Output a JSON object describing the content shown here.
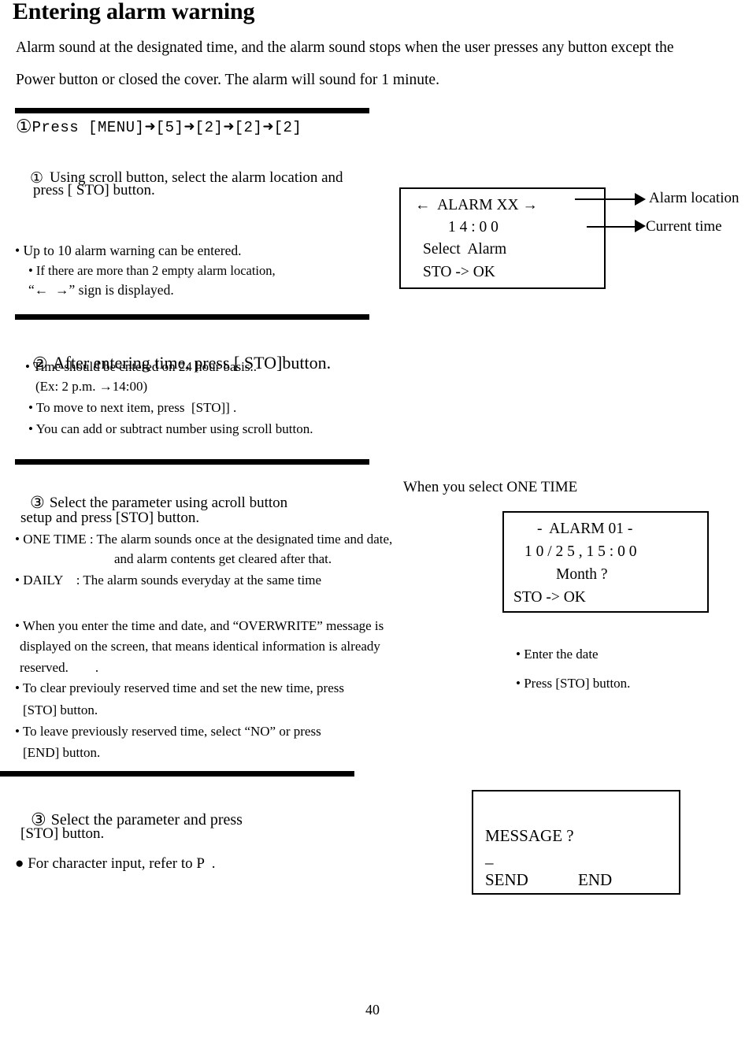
{
  "document": {
    "title": "Entering alarm warning",
    "intro_line1": "Alarm sound at the designated time, and the alarm sound stops when the user presses any button except the",
    "intro_line2": "Power button or closed the cover. The alarm will sound for 1 minute.",
    "page_number": "40"
  },
  "step1": {
    "number": "①",
    "key_sequence_prefix": "Press  [MENU]",
    "arrow": "➜",
    "key1": "[5]",
    "key2": "[2]",
    "key3": "[2]",
    "key4": "[2]",
    "sub_number": "①",
    "sub_line1": "Using scroll button, select the alarm location and",
    "sub_line2": "press [ STO] button.",
    "notes": [
      "• Up to 10 alarm warning can be entered.",
      "• If there are more than 2 empty alarm location,",
      "“←  →” sign is displayed."
    ]
  },
  "lcd1": {
    "line1": "←  ALARM XX →",
    "line2": "1 4 : 0 0",
    "line3": "Select  Alarm",
    "line4": "STO -> OK",
    "callout1": "Alarm location",
    "callout2": "Current time"
  },
  "step2": {
    "number": "②",
    "heading": "After entering time, press [ STO]button.",
    "notes": [
      "• Time should be entered on 24 hour basis..",
      "(Ex: 2 p.m. →14:00)",
      "• To move to next item, press  [STO]] .",
      "• You can add or subtract number using scroll button."
    ]
  },
  "step3": {
    "number": "③",
    "heading": "Select the parameter using acroll button",
    "heading2": "setup and press [STO] button.",
    "right_label": "When you select ONE TIME",
    "notes": [
      "• ONE TIME : The alarm sounds once at the designated time and date,",
      "and alarm contents get cleared after that.",
      "• DAILY    : The alarm sounds everyday at the same time"
    ],
    "overwrite_notes": [
      "• When you enter the time and date, and “OVERWRITE” message is",
      "displayed on the screen, that means identical information is already",
      "reserved.        .",
      "• To clear previouly reserved time and set the new time, press",
      "[STO] button.",
      "• To leave previously reserved time, select “NO” or press",
      "[END] button."
    ]
  },
  "lcd2": {
    "line1": "-  ALARM 01 -",
    "line2": "1 0 / 2 5 , 1 5 : 0 0",
    "line3": "Month ?",
    "line4": "STO -> OK",
    "side_note1": "• Enter the date",
    "side_note2": "• Press [STO] button."
  },
  "step4": {
    "number": "③",
    "heading": "Select the parameter and press",
    "heading2": "[STO] button.",
    "note": "● For character input, refer to P  ."
  },
  "lcd3": {
    "line1": "MESSAGE ?",
    "line2": "–",
    "line3a": "SEND",
    "line3b": "END"
  }
}
